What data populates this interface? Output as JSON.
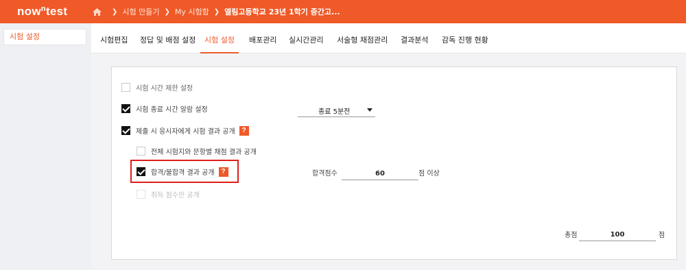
{
  "header": {
    "logo_main": "now",
    "logo_sup": "n",
    "logo_tail": "test",
    "breadcrumbs": [
      "시험 만들기",
      "My 시험함",
      "엘림고등학교 23년 1학기 중간고..."
    ]
  },
  "sidebar": {
    "items": [
      {
        "label": "시험 설정"
      }
    ]
  },
  "tabs": [
    {
      "label": "시험편집"
    },
    {
      "label": "정답 및 배점 설정"
    },
    {
      "label": "시험 설정"
    },
    {
      "label": "배포관리"
    },
    {
      "label": "실시간관리"
    },
    {
      "label": "서술형 채점관리"
    },
    {
      "label": "결과분석"
    },
    {
      "label": "감독 진행 현황"
    }
  ],
  "active_tab": "시험 설정",
  "settings": {
    "time_limit": {
      "label": "시험 시간 제한 설정",
      "checked": false
    },
    "end_alarm": {
      "label": "시험 종료 시간 알람 설정",
      "checked": true,
      "select_value": "종료 5분전"
    },
    "show_result": {
      "label": "제출 시 응시자에게 시험 결과 공개",
      "checked": true,
      "help": "?"
    },
    "full_result": {
      "label": "전체 시험지와 문항별 채점 결과 공개",
      "checked": false
    },
    "pass_fail": {
      "label": "합격/불합격 결과 공개",
      "checked": true,
      "help": "?"
    },
    "score_only": {
      "label": "취득 점수만 공개",
      "checked": false,
      "disabled": true
    },
    "pass_score": {
      "label": "합격점수",
      "value": "60",
      "suffix": "점 이상"
    },
    "total": {
      "label": "총점",
      "value": "100",
      "suffix": "점"
    }
  },
  "colors": {
    "accent": "#ef5a28",
    "highlight": "#e11b1b"
  }
}
